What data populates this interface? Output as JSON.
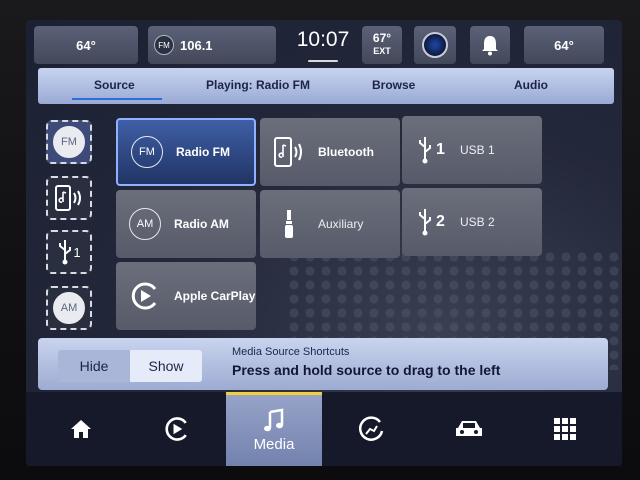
{
  "status_bar": {
    "left_temp": "64°",
    "radio_badge": "FM",
    "radio_station": "106.1",
    "clock": "10:07",
    "ext_temp": "67°",
    "ext_label": "EXT",
    "right_temp": "64°"
  },
  "tabs": [
    {
      "label": "Source"
    },
    {
      "label": "Playing: Radio FM"
    },
    {
      "label": "Browse"
    },
    {
      "label": "Audio"
    }
  ],
  "shortcuts": [
    {
      "icon": "fm-icon",
      "label": "FM"
    },
    {
      "icon": "bluetooth-phone-icon"
    },
    {
      "icon": "usb-icon",
      "label": "1"
    },
    {
      "icon": "am-icon",
      "label": "AM"
    }
  ],
  "sources": {
    "radio_fm": {
      "badge": "FM",
      "label": "Radio FM"
    },
    "bluetooth": {
      "label": "Bluetooth"
    },
    "usb1": {
      "num": "1",
      "label": "USB 1"
    },
    "radio_am": {
      "badge": "AM",
      "label": "Radio AM"
    },
    "auxiliary": {
      "label": "Auxiliary"
    },
    "usb2": {
      "num": "2",
      "label": "USB 2"
    },
    "carplay": {
      "label": "Apple CarPlay"
    }
  },
  "info": {
    "hide": "Hide",
    "show": "Show",
    "title": "Media Source Shortcuts",
    "text": "Press and hold source to drag to the left"
  },
  "nav": {
    "media_label": "Media"
  },
  "colors": {
    "accent": "#2d6fd8",
    "active_tile": "#3f5fa6",
    "media_highlight": "#f5cf36"
  }
}
